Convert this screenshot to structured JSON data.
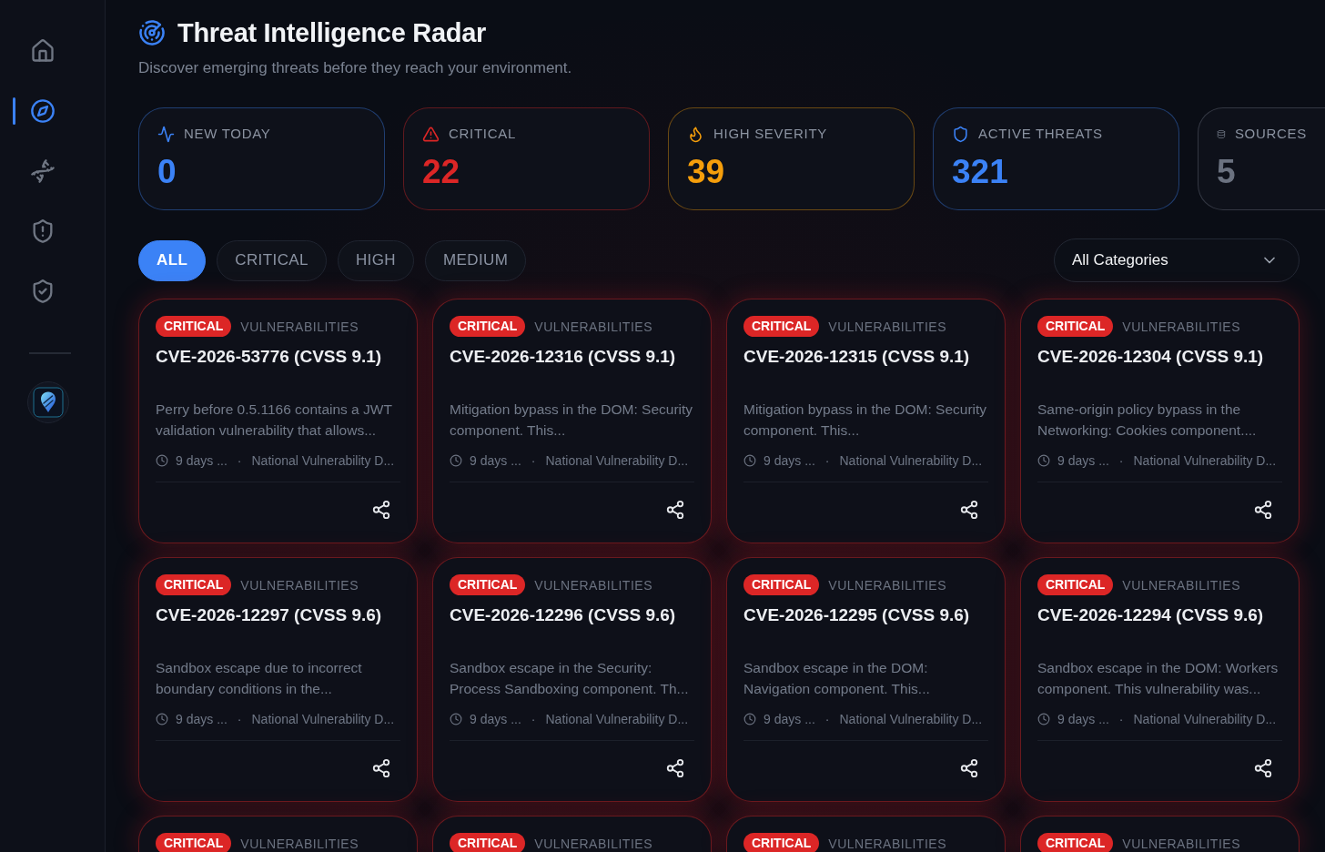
{
  "sidebar": {
    "items": [
      {
        "selected": false
      },
      {
        "selected": true
      },
      {
        "selected": false
      },
      {
        "selected": false
      },
      {
        "selected": false
      }
    ]
  },
  "header": {
    "title": "Threat Intelligence Radar",
    "subtitle": "Discover emerging threats before they reach your environment."
  },
  "stats": [
    {
      "label": "NEW TODAY",
      "value": "0",
      "color": "#3b82f6"
    },
    {
      "label": "CRITICAL",
      "value": "22",
      "color": "#dc2626"
    },
    {
      "label": "HIGH SEVERITY",
      "value": "39",
      "color": "#f59e0b"
    },
    {
      "label": "ACTIVE THREATS",
      "value": "321",
      "color": "#3b82f6"
    },
    {
      "label": "SOURCES",
      "value": "5",
      "color": "#6b7280"
    }
  ],
  "filters": [
    {
      "label": "ALL",
      "selected": true
    },
    {
      "label": "CRITICAL",
      "selected": false
    },
    {
      "label": "HIGH",
      "selected": false
    },
    {
      "label": "MEDIUM",
      "selected": false
    }
  ],
  "category_filter": {
    "value": "All Categories"
  },
  "threats": [
    {
      "severity": "CRITICAL",
      "category": "VULNERABILITIES",
      "title": "CVE-2026-53776 (CVSS 9.1)",
      "description": "Perry before 0.5.1166 contains a JWT validation vulnerability that allows...",
      "age": "9 days ...",
      "separator": "·",
      "source": "National Vulnerability D..."
    },
    {
      "severity": "CRITICAL",
      "category": "VULNERABILITIES",
      "title": "CVE-2026-12316 (CVSS 9.1)",
      "description": "Mitigation bypass in the DOM: Security component. This...",
      "age": "9 days ...",
      "separator": "·",
      "source": "National Vulnerability D..."
    },
    {
      "severity": "CRITICAL",
      "category": "VULNERABILITIES",
      "title": "CVE-2026-12315 (CVSS 9.1)",
      "description": "Mitigation bypass in the DOM: Security component. This...",
      "age": "9 days ...",
      "separator": "·",
      "source": "National Vulnerability D..."
    },
    {
      "severity": "CRITICAL",
      "category": "VULNERABILITIES",
      "title": "CVE-2026-12304 (CVSS 9.1)",
      "description": "Same-origin policy bypass in the Networking: Cookies component....",
      "age": "9 days ...",
      "separator": "·",
      "source": "National Vulnerability D..."
    },
    {
      "severity": "CRITICAL",
      "category": "VULNERABILITIES",
      "title": "CVE-2026-12297 (CVSS 9.6)",
      "description": "Sandbox escape due to incorrect boundary conditions in the...",
      "age": "9 days ...",
      "separator": "·",
      "source": "National Vulnerability D..."
    },
    {
      "severity": "CRITICAL",
      "category": "VULNERABILITIES",
      "title": "CVE-2026-12296 (CVSS 9.6)",
      "description": "Sandbox escape in the Security: Process Sandboxing component. Th...",
      "age": "9 days ...",
      "separator": "·",
      "source": "National Vulnerability D..."
    },
    {
      "severity": "CRITICAL",
      "category": "VULNERABILITIES",
      "title": "CVE-2026-12295 (CVSS 9.6)",
      "description": "Sandbox escape in the DOM: Navigation component. This...",
      "age": "9 days ...",
      "separator": "·",
      "source": "National Vulnerability D..."
    },
    {
      "severity": "CRITICAL",
      "category": "VULNERABILITIES",
      "title": "CVE-2026-12294 (CVSS 9.6)",
      "description": "Sandbox escape in the DOM: Workers component. This vulnerability was...",
      "age": "9 days ...",
      "separator": "·",
      "source": "National Vulnerability D..."
    },
    {
      "severity": "CRITICAL",
      "category": "VULNERABILITIES"
    },
    {
      "severity": "CRITICAL",
      "category": "VULNERABILITIES"
    },
    {
      "severity": "CRITICAL",
      "category": "VULNERABILITIES"
    },
    {
      "severity": "CRITICAL",
      "category": "VULNERABILITIES"
    }
  ]
}
